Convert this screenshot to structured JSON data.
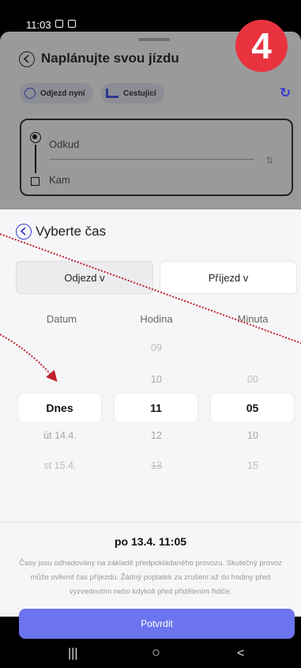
{
  "status_bar": {
    "time": "11:03"
  },
  "badge": {
    "number": "4",
    "color": "#e8333f"
  },
  "background_screen": {
    "title": "Naplánujte svou jízdu",
    "chips": [
      "Odjezd nyní",
      "Cestující"
    ],
    "from_label": "Odkud",
    "to_label": "Kam"
  },
  "sheet": {
    "title": "Vyberte čas",
    "tabs": [
      {
        "label": "Odjezd v",
        "selected": true
      },
      {
        "label": "Příjezd v",
        "selected": false
      }
    ],
    "columns": {
      "date": {
        "header": "Datum",
        "selected": "Dnes",
        "after": [
          "út 14.4.",
          "st 15.4."
        ]
      },
      "hour": {
        "header": "Hodina",
        "before": [
          "09",
          "10"
        ],
        "selected": "11",
        "after": [
          "12",
          "13"
        ]
      },
      "minute": {
        "header": "Minuta",
        "before": [
          "00"
        ],
        "selected": "05",
        "after": [
          "10",
          "15"
        ]
      }
    },
    "summary": "po 13.4. 11:05",
    "note": "Časy jsou odhadovány na základě předpokládaného provozu. Skutečný provoz může ovlivnit čas příjezdu. Žádný poplatek za zrušení až do hodiny před vyzvednutím nebo kdykoli před přidělením řidiče.",
    "confirm_label": "Potvrdit",
    "accent_color": "#6b74ee"
  },
  "nav_bar": {
    "recent": "|||",
    "home": "○",
    "back": "<"
  }
}
